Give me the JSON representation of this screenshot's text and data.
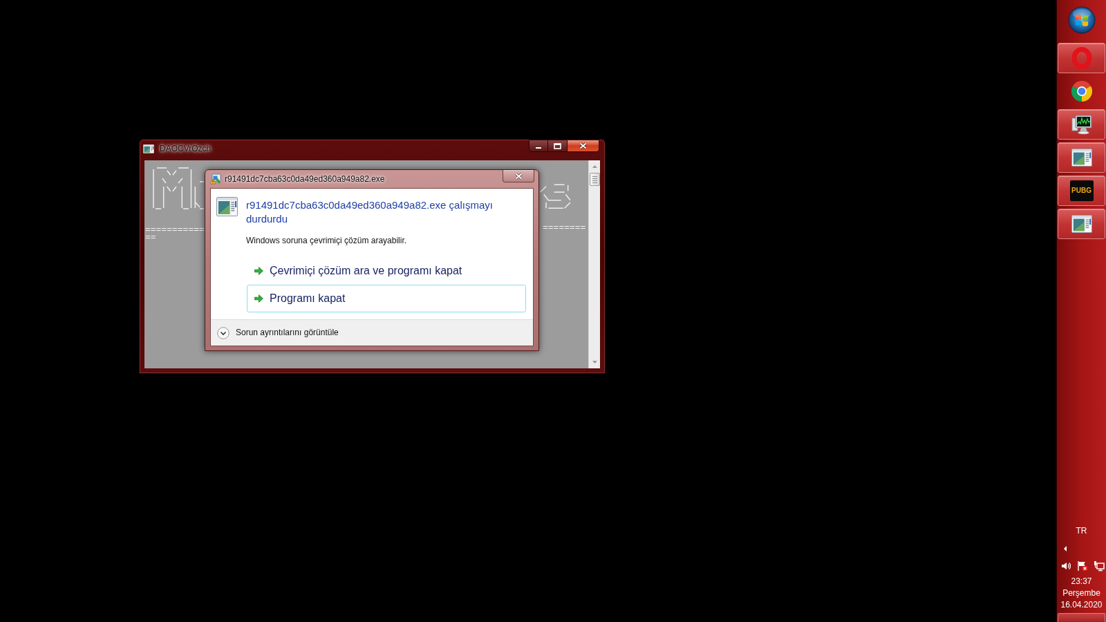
{
  "console_window": {
    "title": "DAOCVrOzch",
    "left_lines": [
      "===========",
      "=="
    ],
    "right_lines": [
      "========"
    ]
  },
  "error_dialog": {
    "title": "r91491dc7cba63c0da49ed360a949a82.exe",
    "heading": "r91491dc7cba63c0da49ed360a949a82.exe çalışmayı durdurdu",
    "message": "Windows soruna çevrimiçi çözüm arayabilir.",
    "options": [
      {
        "label": "Çevrimiçi çözüm ara ve programı kapat",
        "focused": false
      },
      {
        "label": "Programı kapat",
        "focused": true
      }
    ],
    "details": {
      "label": "Sorun ayrıntılarını görüntüle",
      "expanded": false
    }
  },
  "taskbar": {
    "items": [
      {
        "kind": "ring",
        "running": true
      },
      {
        "kind": "wheel",
        "running": false
      },
      {
        "kind": "monitor",
        "running": true
      },
      {
        "kind": "window",
        "running": true
      },
      {
        "kind": "game",
        "label": "PUBG",
        "running": true
      },
      {
        "kind": "window",
        "running": true
      }
    ],
    "tray": {
      "language": "TR",
      "time": "23:37",
      "weekday": "Perşembe",
      "date": "16.04.2020"
    }
  }
}
